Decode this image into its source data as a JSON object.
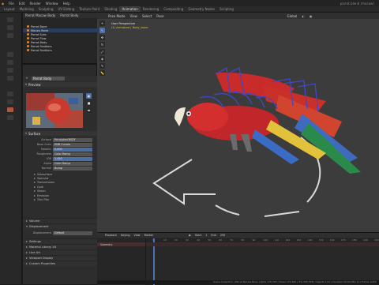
{
  "topbar": {
    "menus": [
      "Scripting",
      "Animation",
      "Rendering",
      "Compositing",
      "Geometry Nodes",
      "Scripting"
    ],
    "title": "parrot.blend (macaw)"
  },
  "tabs": {
    "items": [
      "Layout",
      "Modeling",
      "Sculpting",
      "UV Editing",
      "Texture Paint",
      "Shading",
      "Animation",
      "Rendering",
      "Compositing",
      "Geometry Nodes",
      "Scripting"
    ],
    "active_index": 6
  },
  "outliner": {
    "items": [
      "Parrot Bone",
      "Macaw Bone",
      "Parrot Eyes",
      "Parrot Flow",
      "Parrot Body",
      "Parrot Feathers",
      "Parrot Feathers"
    ],
    "selected_index": 1,
    "header_a": "Parrot Macaw Body",
    "header_b": "Parrot Body"
  },
  "properties": {
    "object_name": "Parrot Body",
    "preview_label": "Preview",
    "surface_label": "Surface",
    "rows": [
      {
        "label": "Surface",
        "value": "Principled BSDF"
      },
      {
        "label": "Base Color",
        "value": "RNB Curves"
      },
      {
        "label": "Metallic",
        "value": "0.000"
      },
      {
        "label": "Roughness",
        "value": "Color Ramp"
      },
      {
        "label": "IOR",
        "value": "1.450"
      },
      {
        "label": "Alpha",
        "value": "Color Ramp"
      },
      {
        "label": "Normal",
        "value": "Bump"
      }
    ],
    "subitems": [
      "Subsurface",
      "Specular",
      "Transmission",
      "Coat",
      "Sheen",
      "Emission",
      "Thin Film"
    ],
    "sections": [
      "Volume",
      "Displacement",
      "Settings",
      "Material Library VX",
      "Line Art",
      "Viewport Display",
      "Custom Properties"
    ],
    "displacement_row": {
      "label": "Displacement",
      "value": "Default"
    }
  },
  "viewport": {
    "header_menus": [
      "Pose Mode",
      "View",
      "Select",
      "Pose"
    ],
    "info_line1": "User Perspective",
    "info_line2": "(1) Armature | Body_bone",
    "right_menu": "Global",
    "tools": [
      "cursor",
      "select",
      "move",
      "rotate",
      "scale",
      "transform",
      "annotate",
      "measure"
    ]
  },
  "timeline": {
    "menus": [
      "Playback",
      "Keying",
      "View",
      "Marker"
    ],
    "channel_label": "Summary",
    "ticks": [
      "0",
      "10",
      "20",
      "30",
      "40",
      "50",
      "60",
      "70",
      "80",
      "90",
      "100",
      "110",
      "120",
      "130",
      "140",
      "150",
      "160",
      "170",
      "180",
      "190",
      "200"
    ],
    "start": "1",
    "end": "250"
  },
  "statusbar": {
    "text": "Scene Collection | Parrot Macaw Bone | Verts 175,743 | Faces 172,664 | Tris 345,328 | Objects 1/11 | Duration 00:00:08+11 | Frame 1/250"
  },
  "colors": {
    "accent": "#4a72b0",
    "selected": "#2c3d5c",
    "orange": "#e08a2c"
  }
}
